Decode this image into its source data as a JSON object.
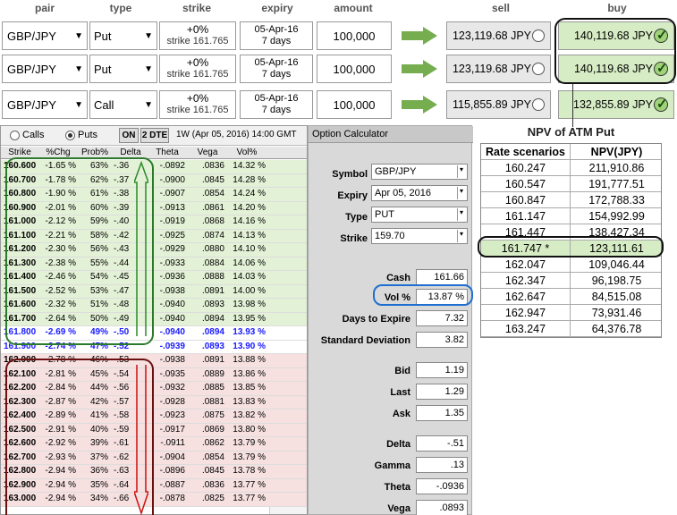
{
  "headers": {
    "pair": "pair",
    "type": "type",
    "strike": "strike",
    "expiry": "expiry",
    "amount": "amount",
    "sell": "sell",
    "buy": "buy"
  },
  "trades": [
    {
      "pair": "GBP/JPY",
      "type": "Put",
      "strike_pct": "+0%",
      "strike": "strike 161.765",
      "expiry_date": "05-Apr-16",
      "expiry_days": "7 days",
      "amount": "100,000",
      "sell": "123,119.68 JPY",
      "buy": "140,119.68 JPY"
    },
    {
      "pair": "GBP/JPY",
      "type": "Put",
      "strike_pct": "+0%",
      "strike": "strike 161.765",
      "expiry_date": "05-Apr-16",
      "expiry_days": "7 days",
      "amount": "100,000",
      "sell": "123,119.68 JPY",
      "buy": "140,119.68 JPY"
    },
    {
      "pair": "GBP/JPY",
      "type": "Call",
      "strike_pct": "+0%",
      "strike": "strike 161.765",
      "expiry_date": "05-Apr-16",
      "expiry_days": "7 days",
      "amount": "100,000",
      "sell": "115,855.89 JPY",
      "buy": "132,855.89 JPY"
    }
  ],
  "toolbar": {
    "calls": "Calls",
    "puts": "Puts",
    "on": "ON",
    "dte": "2 DTE",
    "expiry": "1W (Apr 05, 2016) 14:00 GMT"
  },
  "table_headers": {
    "strike": "Strike",
    "chg": "%Chg",
    "prob": "Prob%",
    "delta": "Delta",
    "theta": "Theta",
    "vega": "Vega",
    "vol": "Vol%"
  },
  "option_rows": [
    {
      "strike": "160.600",
      "chg": "-1.65 %",
      "prob": "63%",
      "delta": "-.36",
      "theta": "-.0892",
      "vega": ".0836",
      "vol": "14.32 %",
      "band": "green"
    },
    {
      "strike": "160.700",
      "chg": "-1.78 %",
      "prob": "62%",
      "delta": "-.37",
      "theta": "-.0900",
      "vega": ".0845",
      "vol": "14.28 %",
      "band": "green"
    },
    {
      "strike": "160.800",
      "chg": "-1.90 %",
      "prob": "61%",
      "delta": "-.38",
      "theta": "-.0907",
      "vega": ".0854",
      "vol": "14.24 %",
      "band": "green"
    },
    {
      "strike": "160.900",
      "chg": "-2.01 %",
      "prob": "60%",
      "delta": "-.39",
      "theta": "-.0913",
      "vega": ".0861",
      "vol": "14.20 %",
      "band": "green"
    },
    {
      "strike": "161.000",
      "chg": "-2.12 %",
      "prob": "59%",
      "delta": "-.40",
      "theta": "-.0919",
      "vega": ".0868",
      "vol": "14.16 %",
      "band": "green"
    },
    {
      "strike": "161.100",
      "chg": "-2.21 %",
      "prob": "58%",
      "delta": "-.42",
      "theta": "-.0925",
      "vega": ".0874",
      "vol": "14.13 %",
      "band": "green"
    },
    {
      "strike": "161.200",
      "chg": "-2.30 %",
      "prob": "56%",
      "delta": "-.43",
      "theta": "-.0929",
      "vega": ".0880",
      "vol": "14.10 %",
      "band": "green"
    },
    {
      "strike": "161.300",
      "chg": "-2.38 %",
      "prob": "55%",
      "delta": "-.44",
      "theta": "-.0933",
      "vega": ".0884",
      "vol": "14.06 %",
      "band": "green"
    },
    {
      "strike": "161.400",
      "chg": "-2.46 %",
      "prob": "54%",
      "delta": "-.45",
      "theta": "-.0936",
      "vega": ".0888",
      "vol": "14.03 %",
      "band": "green"
    },
    {
      "strike": "161.500",
      "chg": "-2.52 %",
      "prob": "53%",
      "delta": "-.47",
      "theta": "-.0938",
      "vega": ".0891",
      "vol": "14.00 %",
      "band": "green"
    },
    {
      "strike": "161.600",
      "chg": "-2.32 %",
      "prob": "51%",
      "delta": "-.48",
      "theta": "-.0940",
      "vega": ".0893",
      "vol": "13.98 %",
      "band": "green"
    },
    {
      "strike": "161.700",
      "chg": "-2.64 %",
      "prob": "50%",
      "delta": "-.49",
      "theta": "-.0940",
      "vega": ".0894",
      "vol": "13.95 %",
      "band": "green"
    },
    {
      "strike": "161.800",
      "chg": "-2.69 %",
      "prob": "49%",
      "delta": "-.50",
      "theta": "-.0940",
      "vega": ".0894",
      "vol": "13.93 %",
      "band": "blue"
    },
    {
      "strike": "161.900",
      "chg": "-2.74 %",
      "prob": "47%",
      "delta": "-.52",
      "theta": "-.0939",
      "vega": ".0893",
      "vol": "13.90 %",
      "band": "blue"
    },
    {
      "strike": "162.000",
      "chg": "-2.78 %",
      "prob": "46%",
      "delta": "-.53",
      "theta": "-.0938",
      "vega": ".0891",
      "vol": "13.88 %",
      "band": "pink"
    },
    {
      "strike": "162.100",
      "chg": "-2.81 %",
      "prob": "45%",
      "delta": "-.54",
      "theta": "-.0935",
      "vega": ".0889",
      "vol": "13.86 %",
      "band": "pink"
    },
    {
      "strike": "162.200",
      "chg": "-2.84 %",
      "prob": "44%",
      "delta": "-.56",
      "theta": "-.0932",
      "vega": ".0885",
      "vol": "13.85 %",
      "band": "pink"
    },
    {
      "strike": "162.300",
      "chg": "-2.87 %",
      "prob": "42%",
      "delta": "-.57",
      "theta": "-.0928",
      "vega": ".0881",
      "vol": "13.83 %",
      "band": "pink"
    },
    {
      "strike": "162.400",
      "chg": "-2.89 %",
      "prob": "41%",
      "delta": "-.58",
      "theta": "-.0923",
      "vega": ".0875",
      "vol": "13.82 %",
      "band": "pink"
    },
    {
      "strike": "162.500",
      "chg": "-2.91 %",
      "prob": "40%",
      "delta": "-.59",
      "theta": "-.0917",
      "vega": ".0869",
      "vol": "13.80 %",
      "band": "pink"
    },
    {
      "strike": "162.600",
      "chg": "-2.92 %",
      "prob": "39%",
      "delta": "-.61",
      "theta": "-.0911",
      "vega": ".0862",
      "vol": "13.79 %",
      "band": "pink"
    },
    {
      "strike": "162.700",
      "chg": "-2.93 %",
      "prob": "37%",
      "delta": "-.62",
      "theta": "-.0904",
      "vega": ".0854",
      "vol": "13.79 %",
      "band": "pink"
    },
    {
      "strike": "162.800",
      "chg": "-2.94 %",
      "prob": "36%",
      "delta": "-.63",
      "theta": "-.0896",
      "vega": ".0845",
      "vol": "13.78 %",
      "band": "pink"
    },
    {
      "strike": "162.900",
      "chg": "-2.94 %",
      "prob": "35%",
      "delta": "-.64",
      "theta": "-.0887",
      "vega": ".0836",
      "vol": "13.77 %",
      "band": "pink"
    },
    {
      "strike": "163.000",
      "chg": "-2.94 %",
      "prob": "34%",
      "delta": "-.66",
      "theta": "-.0878",
      "vega": ".0825",
      "vol": "13.77 %",
      "band": "pink"
    }
  ],
  "calculator": {
    "title": "Option Calculator",
    "symbol_label": "Symbol",
    "symbol": "GBP/JPY",
    "expiry_label": "Expiry",
    "expiry": "Apr 05, 2016",
    "type_label": "Type",
    "type": "PUT",
    "strike_label": "Strike",
    "strike": "159.70",
    "cash_label": "Cash",
    "cash": "161.66",
    "vol_label": "Vol %",
    "vol": "13.87 %",
    "days_label": "Days to Expire",
    "days": "7.32",
    "sd_label": "Standard Deviation",
    "sd": "3.82",
    "bid_label": "Bid",
    "bid": "1.19",
    "last_label": "Last",
    "last": "1.29",
    "ask_label": "Ask",
    "ask": "1.35",
    "delta_label": "Delta",
    "delta": "-.51",
    "gamma_label": "Gamma",
    "gamma": ".13",
    "theta_label": "Theta",
    "theta": "-.0936",
    "vega_label": "Vega",
    "vega": ".0893"
  },
  "npv": {
    "title": "NPV of ATM Put",
    "col1": "Rate scenarios",
    "col2": "NPV(JPY)",
    "rows": [
      {
        "rate": "160.247",
        "npv": "211,910.86"
      },
      {
        "rate": "160.547",
        "npv": "191,777.51"
      },
      {
        "rate": "160.847",
        "npv": "172,788.33"
      },
      {
        "rate": "161.147",
        "npv": "154,992.99"
      },
      {
        "rate": "161.447",
        "npv": "138,427.34"
      },
      {
        "rate": "161.747 *",
        "npv": "123,111.61",
        "highlight": true
      },
      {
        "rate": "162.047",
        "npv": "109,046.44"
      },
      {
        "rate": "162.347",
        "npv": "96,198.75"
      },
      {
        "rate": "162.647",
        "npv": "84,515.08"
      },
      {
        "rate": "162.947",
        "npv": "73,931.46"
      },
      {
        "rate": "163.247",
        "npv": "64,376.78"
      }
    ]
  },
  "colors": {
    "green_band": "#e3f1d6",
    "pink_band": "#f6e0e0",
    "atm_blue": "#1a1aff",
    "buy_bg": "#d6ecc4",
    "green_arrow": "#76ad4f"
  }
}
